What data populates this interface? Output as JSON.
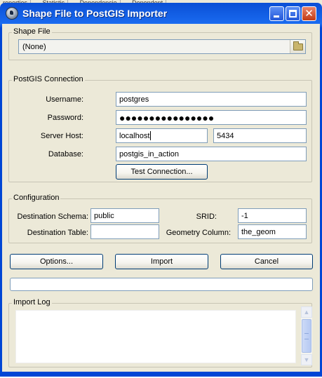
{
  "background_tabs": [
    "roperties",
    "Statistic",
    "Dependencie",
    "Dependent"
  ],
  "window": {
    "title": "Shape File to PostGIS Importer",
    "controls": {
      "minimize_icon": "minimize-icon",
      "maximize_icon": "maximize-icon",
      "close_icon": "close-icon"
    }
  },
  "shape_file": {
    "legend": "Shape File",
    "value": "(None)",
    "browse_icon": "folder-icon"
  },
  "connection": {
    "legend": "PostGIS Connection",
    "username_label": "Username:",
    "username": "postgres",
    "password_label": "Password:",
    "password_masked": "●●●●●●●●●●●●●●●●",
    "server_label": "Server Host:",
    "host": "localhost",
    "port": "5434",
    "database_label": "Database:",
    "database": "postgis_in_action",
    "test_button": "Test Connection..."
  },
  "configuration": {
    "legend": "Configuration",
    "schema_label": "Destination Schema:",
    "schema": "public",
    "srid_label": "SRID:",
    "srid": "-1",
    "table_label": "Destination Table:",
    "table": "",
    "geom_label": "Geometry Column:",
    "geom": "the_geom"
  },
  "actions": {
    "options": "Options...",
    "import": "Import",
    "cancel": "Cancel"
  },
  "progress": {
    "value": 0
  },
  "log": {
    "legend": "Import Log",
    "text": ""
  },
  "colors": {
    "titlebar": "#0a4fd6",
    "dialog": "#ece9d8",
    "input_border": "#7f9db9",
    "button_border": "#003c74"
  }
}
